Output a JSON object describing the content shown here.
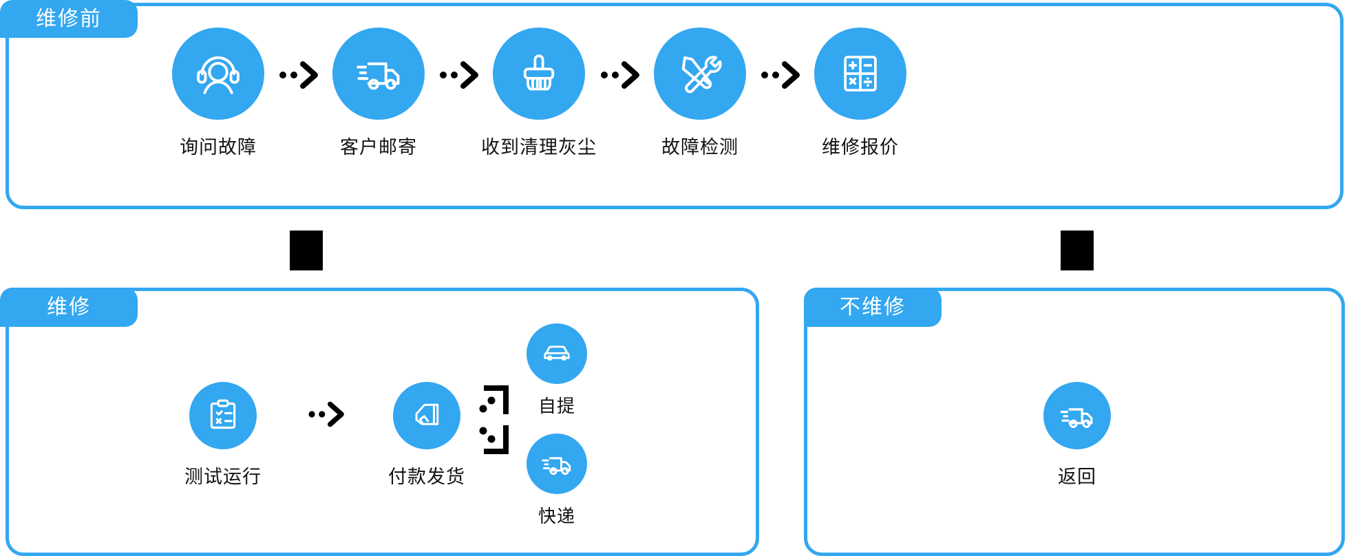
{
  "diagram": {
    "title_colors": {
      "accent": "#33a7f0",
      "panel_border": "#33a7f0",
      "bubble_fill": "#33a7f0",
      "icon_stroke": "#ffffff",
      "arrow": "#000000",
      "label_text": "#121212",
      "tab_text": "#ffffff",
      "background": "#ffffff"
    },
    "panels": [
      {
        "id": "before-repair",
        "tab_label": "维修前",
        "steps": [
          {
            "icon": "headset-support-icon",
            "label": "询问故障"
          },
          {
            "icon": "delivery-truck-icon",
            "label": "客户邮寄"
          },
          {
            "icon": "cleaning-brush-icon",
            "label": "收到清理灰尘"
          },
          {
            "icon": "wrench-screwdriver-icon",
            "label": "故障检测"
          },
          {
            "icon": "calculator-icon",
            "label": "维修报价"
          }
        ]
      },
      {
        "id": "repair",
        "tab_label": "维修",
        "steps": [
          {
            "icon": "clipboard-check-icon",
            "label": "测试运行"
          },
          {
            "icon": "hand-card-payment-icon",
            "label": "付款发货"
          }
        ],
        "branches": [
          {
            "icon": "car-pickup-icon",
            "label": "自提"
          },
          {
            "icon": "courier-truck-icon",
            "label": "快递"
          }
        ]
      },
      {
        "id": "no-repair",
        "tab_label": "不维修",
        "steps": [
          {
            "icon": "return-truck-icon",
            "label": "返回"
          }
        ]
      }
    ],
    "connectors": {
      "chevron_arrow": "chevron-right-dotted-arrow",
      "branch_arrow_up": "elbow-arrow-up-right",
      "branch_arrow_down": "elbow-arrow-down-right",
      "square_marker": "black-square-connector"
    }
  }
}
